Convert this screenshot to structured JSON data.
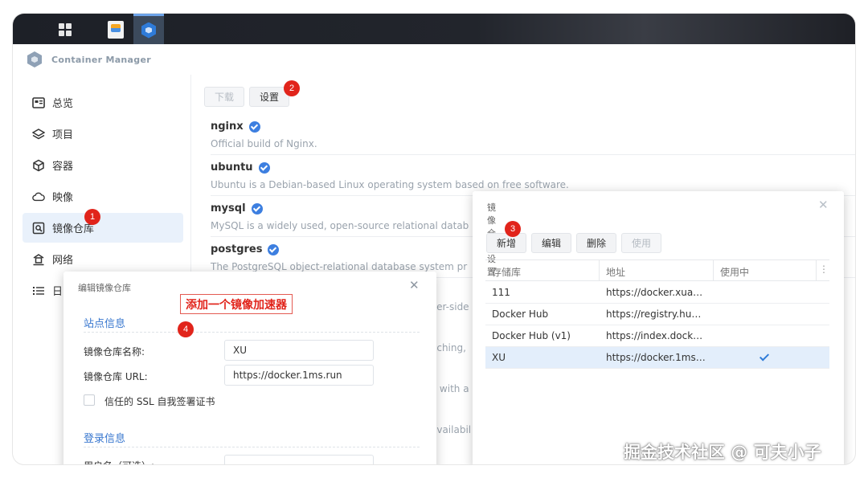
{
  "app": {
    "title": "Container Manager"
  },
  "sidebar": {
    "items": [
      {
        "label": "总览",
        "icon": "overview-icon"
      },
      {
        "label": "项目",
        "icon": "layers-icon"
      },
      {
        "label": "容器",
        "icon": "container-icon"
      },
      {
        "label": "映像",
        "icon": "cloud-icon"
      },
      {
        "label": "镜像仓库",
        "icon": "registry-search-icon"
      },
      {
        "label": "网络",
        "icon": "network-icon"
      },
      {
        "label": "日",
        "icon": "list-icon"
      }
    ]
  },
  "toolbar": {
    "download_label": "下载",
    "settings_label": "设置"
  },
  "images": [
    {
      "name": "nginx",
      "desc": "Official build of Nginx."
    },
    {
      "name": "ubuntu",
      "desc": "Ubuntu is a Debian-based Linux operating system based on free software."
    },
    {
      "name": "mysql",
      "desc": "MySQL is a widely used, open-source relational datab"
    },
    {
      "name": "postgres",
      "desc": "The PostgreSQL object-relational database system pr"
    }
  ],
  "partial_descs": [
    "ver-side",
    "aching,",
    "x with a",
    "availabil"
  ],
  "registry_dialog": {
    "title": "镜像仓库设置",
    "buttons": {
      "add": "新增",
      "edit": "编辑",
      "delete": "删除",
      "use": "使用"
    },
    "columns": [
      "存储库",
      "地址",
      "使用中"
    ],
    "rows": [
      {
        "name": "111",
        "url": "https://docker.xua…",
        "in_use": false
      },
      {
        "name": "Docker Hub",
        "url": "https://registry.hu…",
        "in_use": false
      },
      {
        "name": "Docker Hub (v1)",
        "url": "https://index.dock…",
        "in_use": false
      },
      {
        "name": "XU",
        "url": "https://docker.1ms…",
        "in_use": true
      }
    ]
  },
  "edit_dialog": {
    "title": "编辑镜像仓库",
    "site_section": "站点信息",
    "name_label": "镜像仓库名称:",
    "name_value": "XU",
    "url_label": "镜像仓库 URL:",
    "url_value": "https://docker.1ms.run",
    "ssl_label": "信任的 SSL 自我签署证书",
    "login_section": "登录信息",
    "username_label": "用户名（可选）:"
  },
  "annotations": {
    "callout": "添加一个镜像加速器",
    "badges": [
      "1",
      "2",
      "3",
      "4"
    ]
  },
  "watermark": "掘金技术社区 @ 可夫小子",
  "colors": {
    "accent": "#2f7bd8",
    "badge": "#e1241b",
    "selected_row": "#e3eefb"
  }
}
